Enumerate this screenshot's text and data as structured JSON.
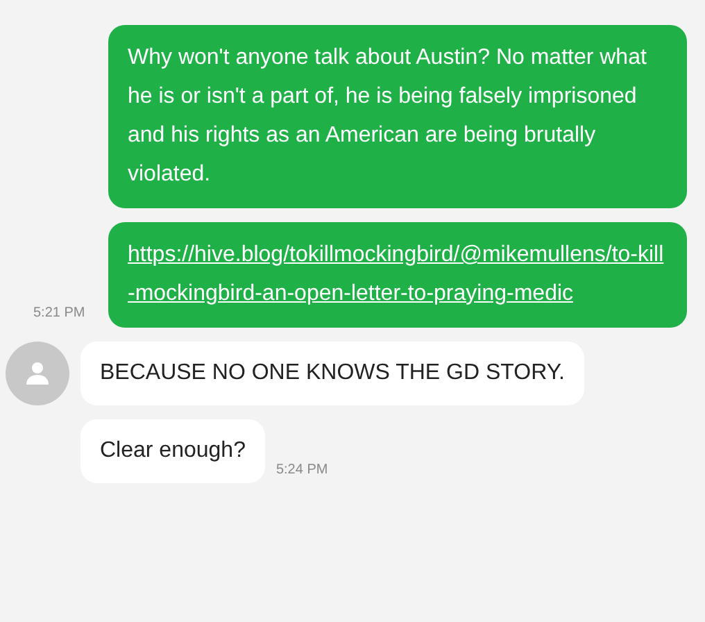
{
  "messages": [
    {
      "sent": true,
      "kind": "text",
      "text": "Why won't anyone talk about Austin? No matter what he is or isn't a part of, he is being falsely imprisoned and his rights as an American are being brutally violated."
    },
    {
      "sent": true,
      "kind": "link",
      "text": "https://hive.blog/tokillmockingbird/@mikemullens/to-kill-mockingbird-an-open-letter-to-praying-medic",
      "time": "5:21 PM"
    },
    {
      "sent": false,
      "kind": "text",
      "avatar": true,
      "text": "BECAUSE NO ONE KNOWS THE GD STORY."
    },
    {
      "sent": false,
      "kind": "text",
      "avatar": false,
      "text": "Clear enough?",
      "time": "5:24 PM"
    }
  ]
}
